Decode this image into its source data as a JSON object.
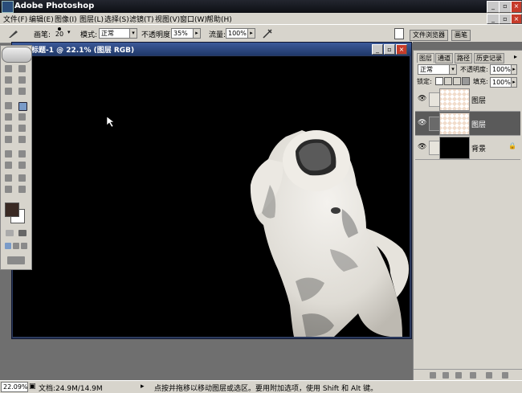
{
  "window": {
    "app_title": "Adobe Photoshop"
  },
  "menubar": {
    "items": [
      "文件(F)",
      "编辑(E)",
      "图像(I)",
      "图层(L)",
      "选择(S)",
      "滤镜(T)",
      "视图(V)",
      "窗口(W)",
      "帮助(H)"
    ]
  },
  "options": {
    "brush_label": "画笔:",
    "brush_size": "20",
    "mode_label": "模式:",
    "mode_value": "正常",
    "opacity_label": "不透明度:",
    "opacity_value": "35%",
    "flow_label": "流量:",
    "flow_value": "100%",
    "file_browser_tab": "文件浏览器",
    "brushes_tab": "画笔"
  },
  "document": {
    "title": "标题-1 @ 22.1% (图层     RGB)"
  },
  "layers_panel": {
    "tabs": [
      "图层",
      "通道",
      "路径",
      "历史记录"
    ],
    "blend_mode": "正常",
    "opacity_label": "不透明度:",
    "opacity_value": "100%",
    "lock_label": "锁定:",
    "fill_label": "填充:",
    "fill_value": "100%",
    "layers": [
      {
        "name": "图层"
      },
      {
        "name": "图层"
      },
      {
        "name": "背景"
      }
    ]
  },
  "statusbar": {
    "zoom": "22.09%",
    "doc_info": "文档:24.9M/14.9M",
    "hint": "点按并拖移以移动图层或选区。要用附加选项，使用 Shift 和 Alt 键。"
  },
  "colors": {
    "canvas": "#000000",
    "panel_bg": "#d7d4cc",
    "title_blue": "#203868"
  }
}
